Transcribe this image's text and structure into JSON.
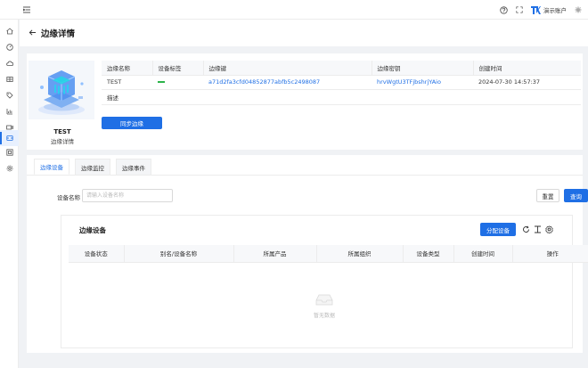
{
  "topbar": {
    "account_name": "演示账户",
    "icons": [
      "menu-toggle-icon",
      "help-icon",
      "fullscreen-icon",
      "brand-logo-icon",
      "settings-icon"
    ]
  },
  "sidebar": {
    "items": [
      "home-icon",
      "dashboard-icon",
      "cloud-icon",
      "grid-icon",
      "tag-icon",
      "chart-icon",
      "video-icon",
      "edge-icon",
      "panel-icon",
      "gear-icon"
    ],
    "active_index": 7
  },
  "page": {
    "title": "边缘详情"
  },
  "edge": {
    "name": "TEST",
    "subtitle": "边缘详情",
    "columns": [
      "边缘名称",
      "设备标签",
      "边缘键",
      "边缘密钥",
      "创建时间"
    ],
    "values": {
      "name": "TEST",
      "tag": "—",
      "key": "a71d2fa3cfd04852877abfb5c2498087",
      "secret": "hrvWgtU3TFjbshrjYAio",
      "created": "2024-07-30 14:57:37"
    },
    "desc_label": "描述",
    "desc_value": "",
    "sync_label": "同步边缘"
  },
  "tabs": [
    {
      "label": "边缘设备",
      "active": true
    },
    {
      "label": "边缘监控",
      "active": false
    },
    {
      "label": "边缘事件",
      "active": false
    }
  ],
  "filter": {
    "label": "设备名称",
    "placeholder": "请输入设备名称",
    "reset_label": "重置",
    "query_label": "查询"
  },
  "list": {
    "title": "边缘设备",
    "assign_label": "分配设备",
    "columns": [
      "设备状态",
      "别名/设备名称",
      "所属产品",
      "所属组织",
      "设备类型",
      "创建时间",
      "操作"
    ],
    "empty_text": "暂无数据"
  },
  "colors": {
    "primary": "#1f6fe5",
    "tag_green": "#2cb34a"
  }
}
